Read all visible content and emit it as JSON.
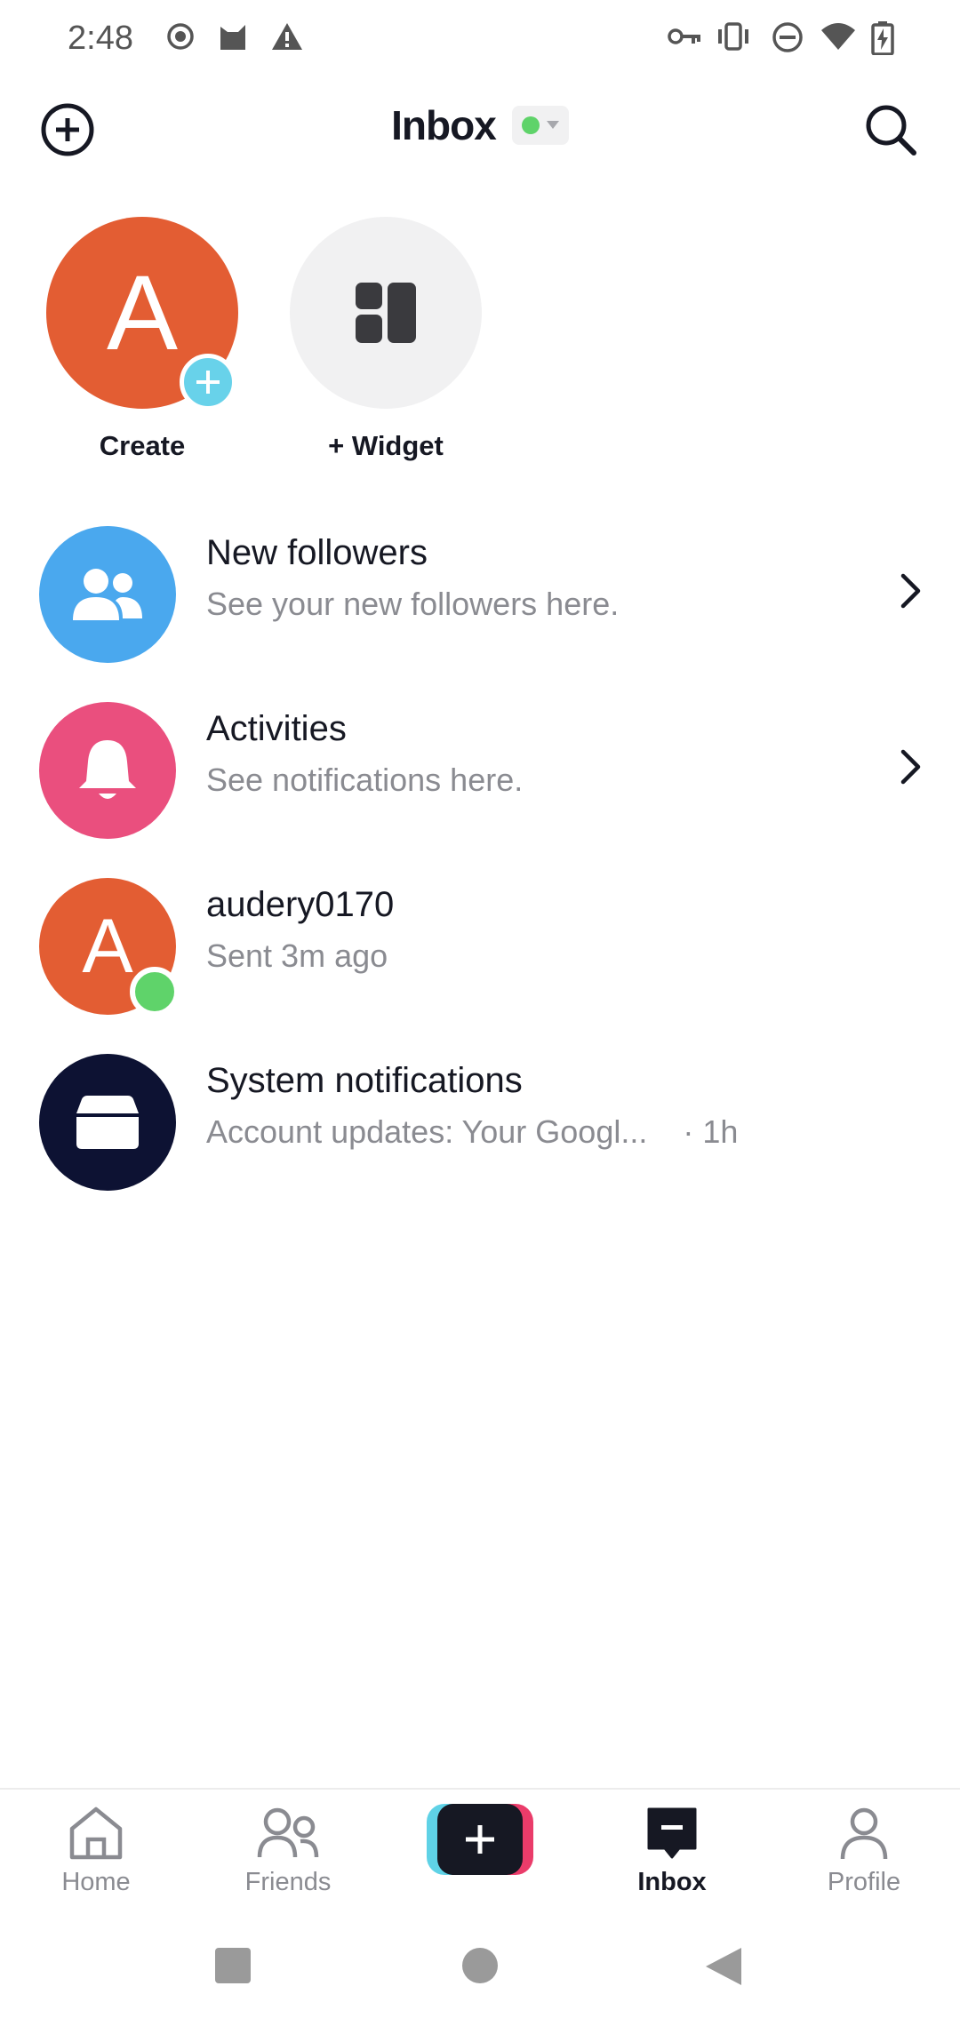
{
  "status_bar": {
    "time": "2:48",
    "left_icons": [
      "record-icon",
      "cat-icon",
      "warning-icon"
    ],
    "right_icons": [
      "key-icon",
      "vibrate-icon",
      "do-not-disturb-icon",
      "wifi-icon",
      "battery-charging-icon"
    ]
  },
  "header": {
    "title": "Inbox",
    "online_status_color": "#5fd36a",
    "left_icon": "add-circle-icon",
    "right_icon": "search-icon"
  },
  "stories": [
    {
      "label": "Create",
      "initial": "A",
      "color": "#e35d33"
    },
    {
      "label": "+ Widget",
      "icon": "widget-icon",
      "color": "#f1f1f2"
    }
  ],
  "inbox_rows": [
    {
      "title": "New followers",
      "subtitle": "See your new followers here.",
      "icon": "followers-icon",
      "color": "#4aa8ee"
    },
    {
      "title": "Activities",
      "subtitle": "See notifications here.",
      "icon": "bell-icon",
      "color": "#ea4f7e"
    },
    {
      "title": "audery0170",
      "subtitle": "Sent 3m ago",
      "initial": "A",
      "color": "#e35d33"
    },
    {
      "title": "System notifications",
      "subtitle": "Account updates: Your Googl...",
      "time": "· 1h",
      "icon": "inbox-tray-icon",
      "color": "#0d1233"
    }
  ],
  "bottom_nav": {
    "home": "Home",
    "friends": "Friends",
    "inbox": "Inbox",
    "profile": "Profile",
    "active": "Inbox"
  },
  "colors": {
    "accent_cyan": "#5fd2e6",
    "accent_pink": "#ea3c6a",
    "text_primary": "#161823",
    "text_secondary": "#8a8b91"
  }
}
